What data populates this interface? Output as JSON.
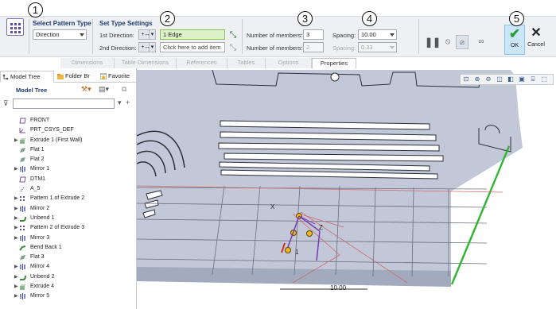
{
  "ribbon": {
    "select_pattern_type": {
      "label": "Select Pattern Type",
      "value": "Direction"
    },
    "set_type_settings": {
      "label": "Set Type Settings",
      "first_direction_label": "1st Direction:",
      "first_direction_flip": "+↔",
      "first_direction_value": "1 Edge",
      "second_direction_label": "2nd Direction:",
      "second_direction_flip": "+↔",
      "second_direction_placeholder": "Click here to add item"
    },
    "members": {
      "first_label": "Number of members:",
      "first_value": "3",
      "second_label": "Number of members:",
      "second_value": "2"
    },
    "spacing": {
      "first_label": "Spacing:",
      "first_value": "10.00",
      "second_label": "Spacing:",
      "second_value": "0.33"
    },
    "ok_label": "OK",
    "cancel_label": "Cancel",
    "tabs": [
      "Dimensions",
      "Table Dimensions",
      "References",
      "Tables",
      "Options",
      "Properties"
    ],
    "active_tab": "Properties",
    "callouts": [
      "1",
      "2",
      "3",
      "4",
      "5"
    ]
  },
  "left_panel": {
    "tabs": [
      "Model Tree",
      "Folder Br",
      "Favorite"
    ],
    "header": "Model Tree",
    "tree_items": [
      {
        "name": "FRONT",
        "expandable": false,
        "icon": "plane-icon"
      },
      {
        "name": "PRT_CSYS_DEF",
        "expandable": false,
        "icon": "csys-icon"
      },
      {
        "name": "Extrude 1 (First Wall)",
        "expandable": true,
        "icon": "extrude-icon"
      },
      {
        "name": "Flat 1",
        "expandable": false,
        "icon": "flat-icon"
      },
      {
        "name": "Flat 2",
        "expandable": false,
        "icon": "flat-icon"
      },
      {
        "name": "Mirror 1",
        "expandable": true,
        "icon": "mirror-icon"
      },
      {
        "name": "DTM1",
        "expandable": false,
        "icon": "plane-icon"
      },
      {
        "name": "A_5",
        "expandable": false,
        "icon": "axis-icon"
      },
      {
        "name": "Pattern 1 of Extrude 2",
        "expandable": true,
        "icon": "pattern-icon"
      },
      {
        "name": "Mirror 2",
        "expandable": true,
        "icon": "mirror-icon"
      },
      {
        "name": "Unbend 1",
        "expandable": true,
        "icon": "unbend-icon"
      },
      {
        "name": "Pattern 2 of Extrude 3",
        "expandable": true,
        "icon": "pattern-icon"
      },
      {
        "name": "Mirror 3",
        "expandable": true,
        "icon": "mirror-icon"
      },
      {
        "name": "Bend Back 1",
        "expandable": false,
        "icon": "bendback-icon"
      },
      {
        "name": "Flat 3",
        "expandable": false,
        "icon": "flat-icon"
      },
      {
        "name": "Mirror 4",
        "expandable": true,
        "icon": "mirror-icon"
      },
      {
        "name": "Unbend 2",
        "expandable": true,
        "icon": "unbend-icon"
      },
      {
        "name": "Extrude 4",
        "expandable": true,
        "icon": "extrude-icon"
      },
      {
        "name": "Mirror 5",
        "expandable": true,
        "icon": "mirror-icon"
      }
    ]
  },
  "graphics": {
    "dim_value": "10.00",
    "preview_label": "1",
    "axis_labels": {
      "x": "X",
      "z": "Z"
    },
    "edge_color": "#2fb52f",
    "part_color": "#c2c8d8"
  }
}
